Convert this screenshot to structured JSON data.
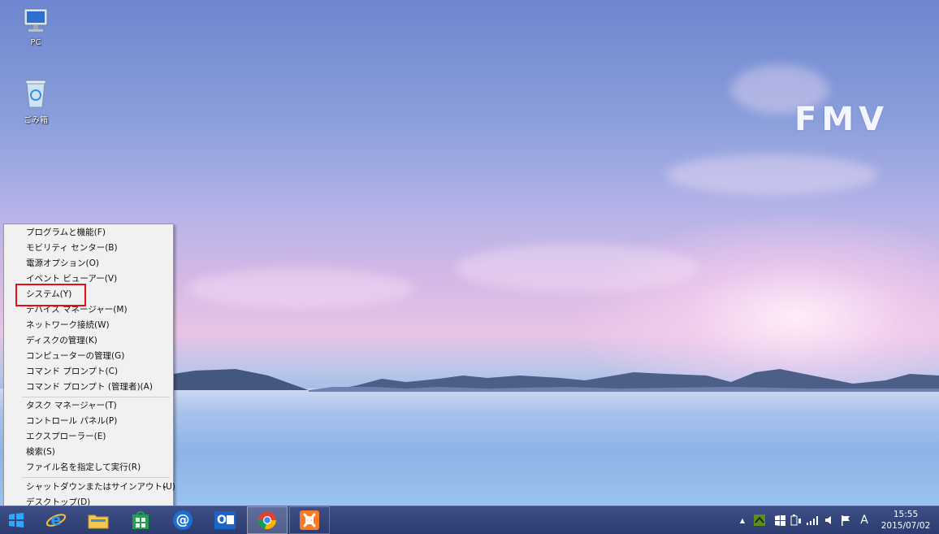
{
  "desktop": {
    "brand_logo": "FMV",
    "icons": [
      {
        "label": "PC",
        "icon": "pc-monitor-icon"
      },
      {
        "label": "ごみ箱",
        "icon": "recycle-bin-icon"
      }
    ]
  },
  "context_menu": {
    "group1": [
      {
        "label": "プログラムと機能(F)"
      },
      {
        "label": "モビリティ センター(B)"
      },
      {
        "label": "電源オプション(O)"
      },
      {
        "label": "イベント ビューアー(V)"
      },
      {
        "label": "システム(Y)",
        "highlighted": true
      },
      {
        "label": "デバイス マネージャー(M)"
      },
      {
        "label": "ネットワーク接続(W)"
      },
      {
        "label": "ディスクの管理(K)"
      },
      {
        "label": "コンピューターの管理(G)"
      },
      {
        "label": "コマンド プロンプト(C)"
      },
      {
        "label": "コマンド プロンプト (管理者)(A)"
      }
    ],
    "group2": [
      {
        "label": "タスク マネージャー(T)"
      },
      {
        "label": "コントロール パネル(P)"
      },
      {
        "label": "エクスプローラー(E)"
      },
      {
        "label": "検索(S)"
      },
      {
        "label": "ファイル名を指定して実行(R)"
      }
    ],
    "group3": [
      {
        "label": "シャットダウンまたはサインアウト(U)",
        "has_submenu": true,
        "submenu_arrow": "▸"
      },
      {
        "label": "デスクトップ(D)"
      }
    ],
    "highlight_color": "#e3101a"
  },
  "taskbar": {
    "start_icon": "windows-start-icon",
    "pinned": [
      {
        "name": "internet-explorer-icon"
      },
      {
        "name": "file-explorer-icon"
      },
      {
        "name": "store-icon"
      },
      {
        "name": "mail-icon",
        "glyph": "@"
      },
      {
        "name": "outlook-icon",
        "glyph": "O"
      },
      {
        "name": "chrome-icon",
        "active": true
      },
      {
        "name": "xampp-icon"
      }
    ],
    "tray": {
      "show_hidden": "▲",
      "ime_mode": "A",
      "time": "15:55",
      "date": "2015/07/02"
    }
  },
  "colors": {
    "taskbar_bg": "#2f3f73",
    "menu_bg": "#f1f1f1"
  }
}
